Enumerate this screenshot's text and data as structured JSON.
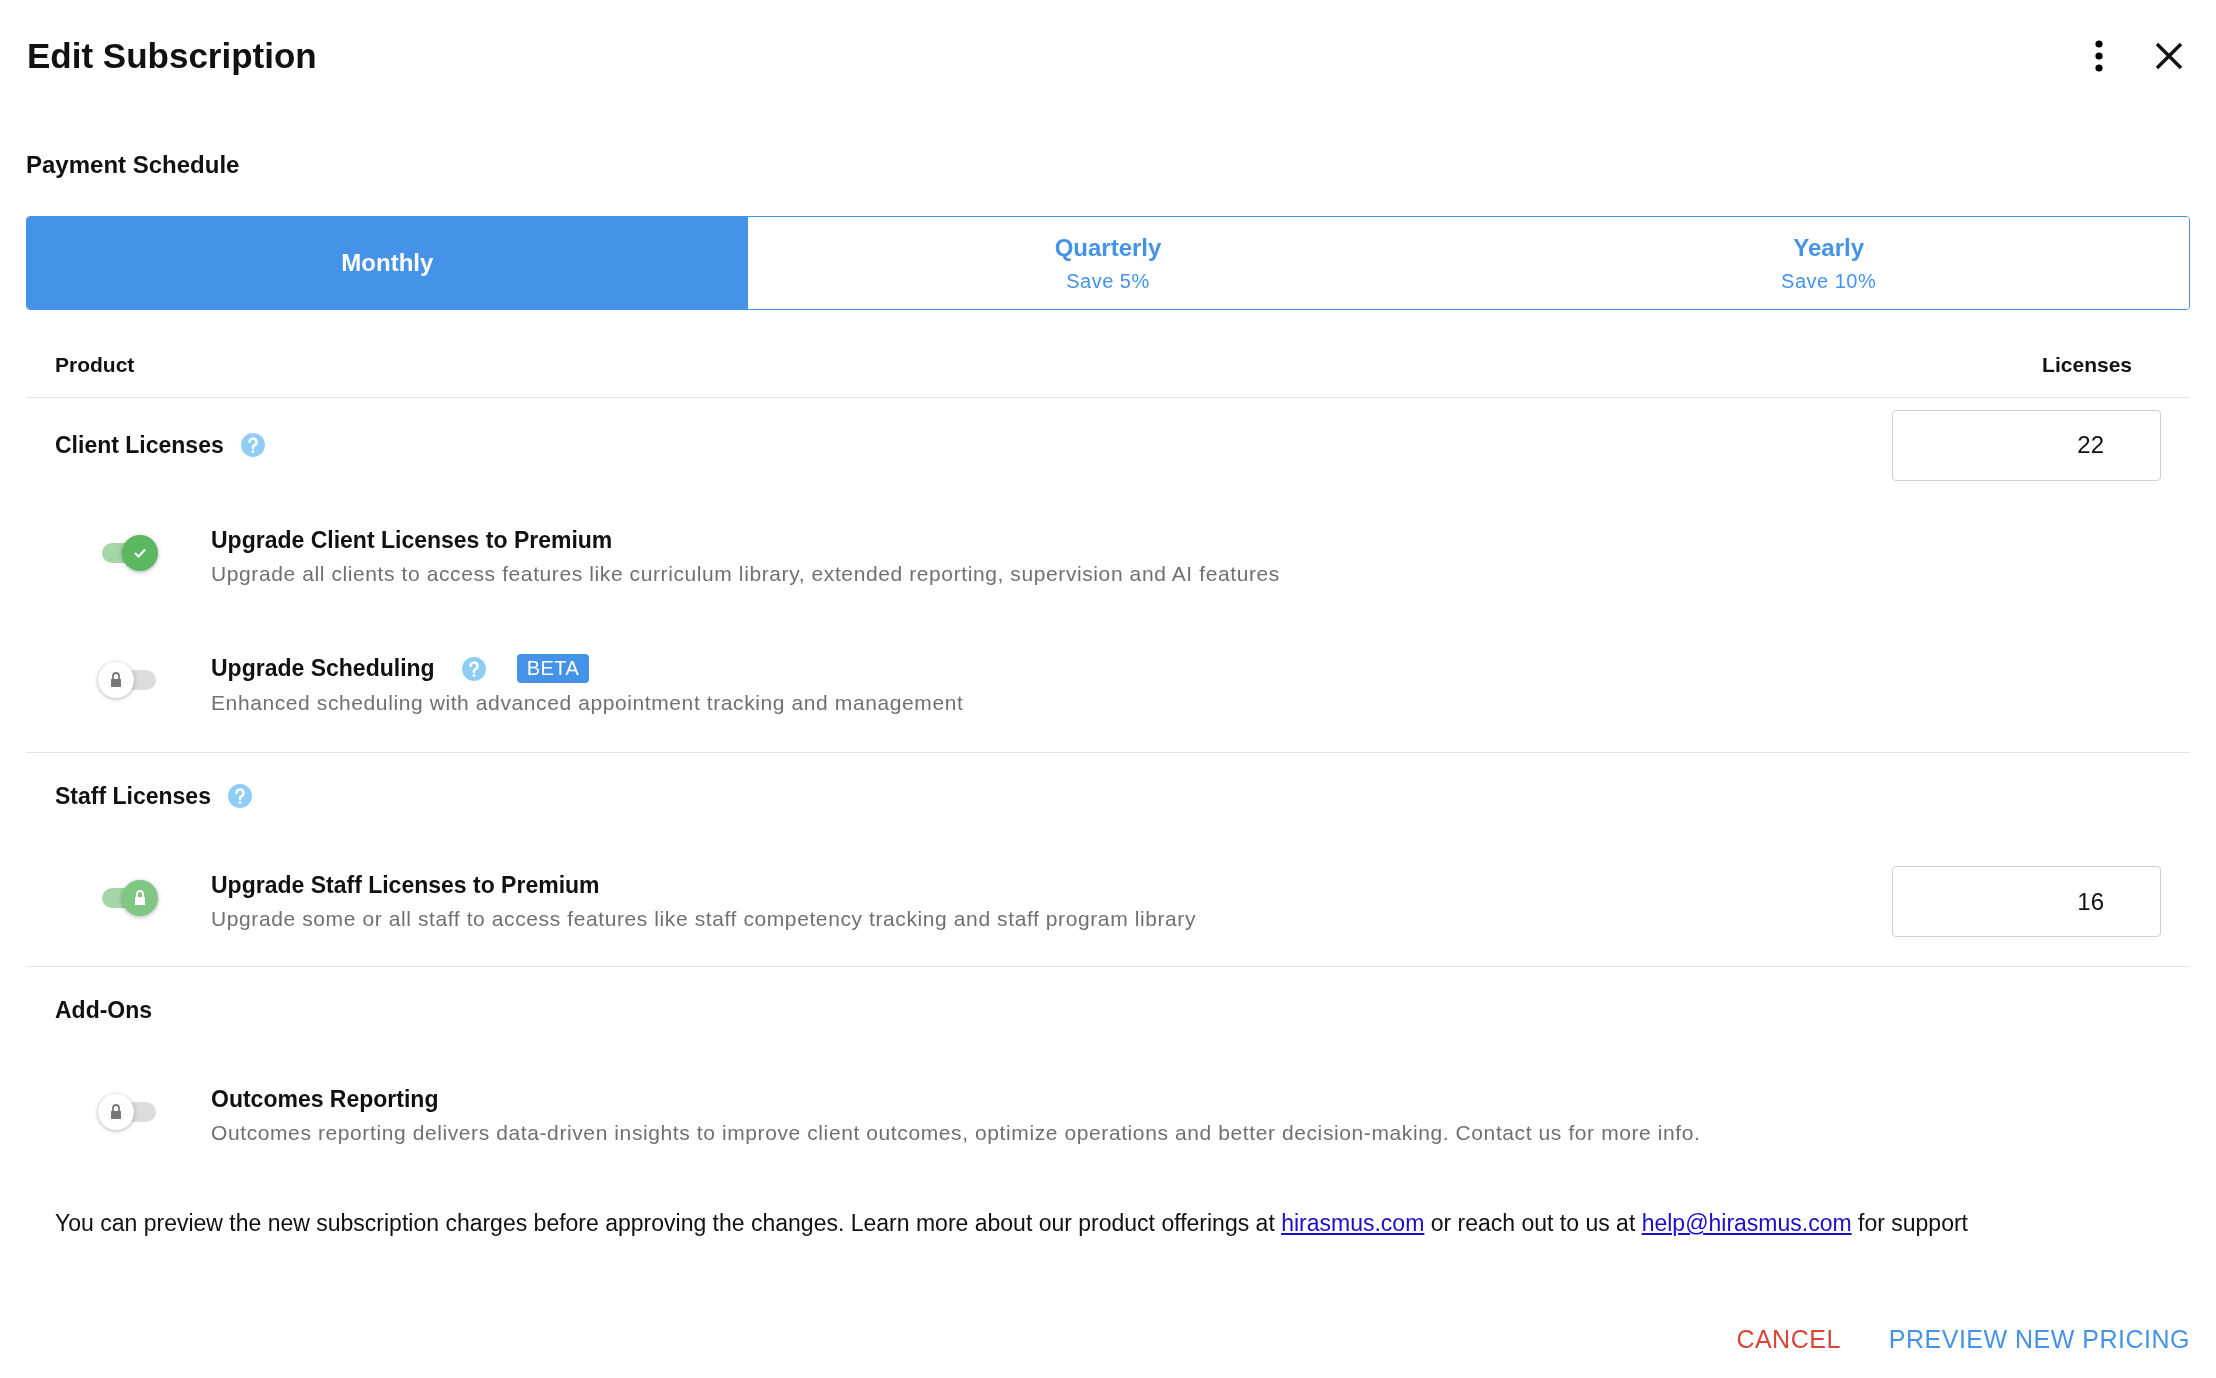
{
  "dialog": {
    "title": "Edit Subscription"
  },
  "payment_schedule": {
    "label": "Payment Schedule",
    "options": [
      {
        "label": "Monthly",
        "selected": true
      },
      {
        "label": "Quarterly",
        "savings": "Save 5%",
        "selected": false
      },
      {
        "label": "Yearly",
        "savings": "Save 10%",
        "selected": false
      }
    ]
  },
  "table": {
    "columns": [
      "Product",
      "Licenses"
    ],
    "sections": [
      {
        "title": "Client Licenses",
        "help": true,
        "licenses": "22",
        "items": [
          {
            "title": "Upgrade Client Licenses to Premium",
            "description": "Upgrade all clients to access features like curriculum library, extended reporting, supervision and AI features",
            "on": true,
            "locked": false,
            "help": false
          },
          {
            "title": "Upgrade Scheduling",
            "description": "Enhanced scheduling with advanced appointment tracking and management",
            "on": false,
            "locked": true,
            "help": true,
            "badge": "BETA"
          }
        ]
      },
      {
        "title": "Staff Licenses",
        "help": true,
        "items": [
          {
            "title": "Upgrade Staff Licenses to Premium",
            "description": "Upgrade some or all staff to access features like staff competency tracking and staff program library",
            "on": true,
            "locked": true,
            "help": false,
            "licenses": "16"
          }
        ]
      },
      {
        "title": "Add-Ons",
        "help": false,
        "items": [
          {
            "title": "Outcomes Reporting",
            "description": "Outcomes reporting delivers data-driven insights to improve client outcomes, optimize operations and better decision-making. Contact us for more info.",
            "on": false,
            "locked": true,
            "help": false
          }
        ]
      }
    ]
  },
  "note": [
    {
      "kind": "text",
      "text": "You can preview the new subscription charges before approving the changes. Learn more about our product offerings at "
    },
    {
      "kind": "link",
      "text": "hirasmus.com"
    },
    {
      "kind": "text",
      "text": " or reach out to us at "
    },
    {
      "kind": "link",
      "text": "help@hirasmus.com"
    },
    {
      "kind": "text",
      "text": " for support"
    }
  ],
  "actions": [
    {
      "label": "CANCEL",
      "kind": "cancel"
    },
    {
      "label": "PREVIEW NEW PRICING",
      "kind": "primary"
    }
  ]
}
